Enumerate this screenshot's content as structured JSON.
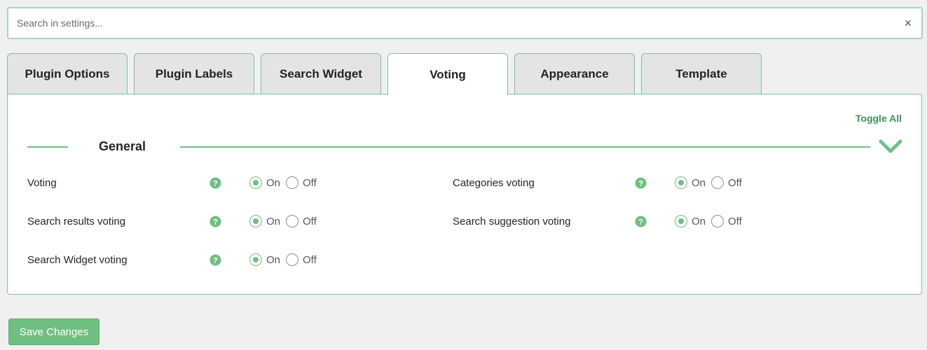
{
  "search": {
    "placeholder": "Search in settings...",
    "value": "",
    "clear_label": "×"
  },
  "tabs": [
    {
      "label": "Plugin Options",
      "active": false
    },
    {
      "label": "Plugin Labels",
      "active": false
    },
    {
      "label": "Search Widget",
      "active": false
    },
    {
      "label": "Voting",
      "active": true
    },
    {
      "label": "Appearance",
      "active": false
    },
    {
      "label": "Template",
      "active": false
    }
  ],
  "panel": {
    "toggle_all_label": "Toggle All",
    "section_title": "General",
    "settings": [
      {
        "label": "Voting",
        "value": "On"
      },
      {
        "label": "Search results voting",
        "value": "On"
      },
      {
        "label": "Search Widget voting",
        "value": "On"
      },
      {
        "label": "Categories voting",
        "value": "On"
      },
      {
        "label": "Search suggestion voting",
        "value": "On"
      }
    ],
    "on_label": "On",
    "off_label": "Off"
  },
  "footer": {
    "save_label": "Save Changes"
  },
  "colors": {
    "accent": "#6fbf82",
    "tab_border": "#7fc48f",
    "link": "#3f8f5a"
  },
  "icons": {
    "help": "question-circle-icon",
    "collapse": "chevron-down-icon",
    "clear": "close-icon"
  }
}
